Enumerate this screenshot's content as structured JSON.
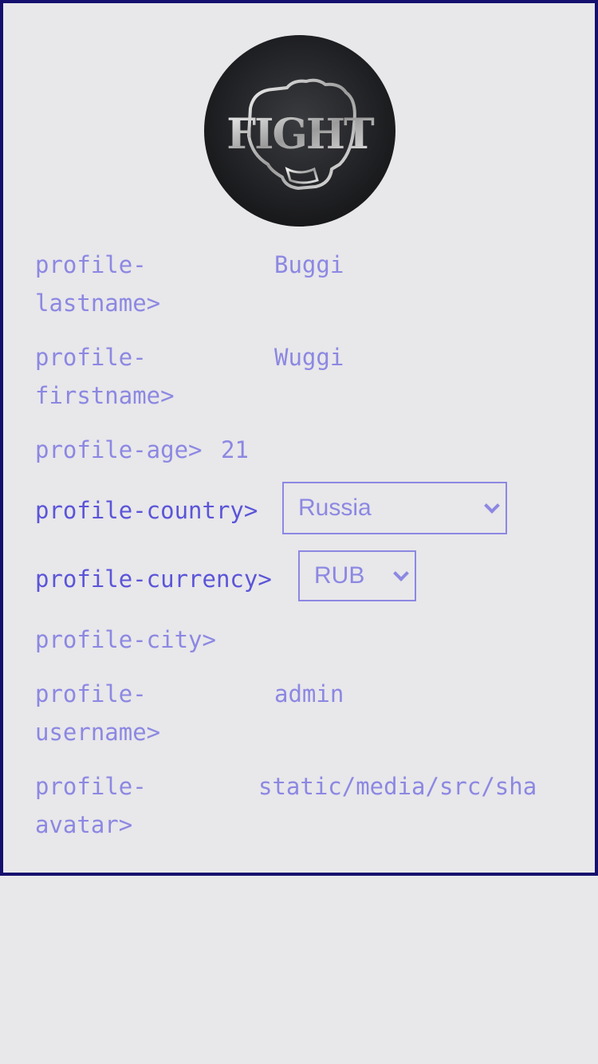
{
  "profile": {
    "avatar_icon": "fight-fist-logo-icon",
    "lastname": {
      "label": "profile-\nlastname>",
      "value": "Buggi"
    },
    "firstname": {
      "label": "profile-\nfirstname>",
      "value": "Wuggi"
    },
    "age": {
      "label": "profile-age>",
      "value": "21"
    },
    "country": {
      "label": "profile-country>",
      "selected": "Russia"
    },
    "currency": {
      "label": "profile-currency>",
      "selected": "RUB"
    },
    "city": {
      "label": "profile-city>",
      "value": ""
    },
    "username": {
      "label": "profile-\nusername>",
      "value": "admin"
    },
    "avatar": {
      "label": "profile-\navatar>",
      "value": "static/media/src/sha"
    }
  },
  "colors": {
    "border": "#15106e",
    "text": "#8c88e2",
    "text_strong": "#5b55d8",
    "background": "#e8e7ea"
  }
}
